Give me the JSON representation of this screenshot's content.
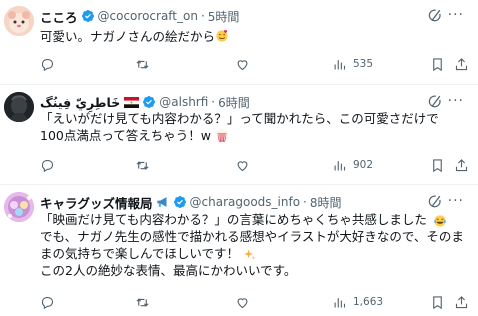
{
  "posts": [
    {
      "name": "こころ",
      "handle": "@cocorocraft_on",
      "sep": "·",
      "time": "5時間",
      "text": "可愛い。ナガノさんの絵だから",
      "views": "535"
    },
    {
      "name": "خَاطِرِيّ فِينُگ",
      "handle": "@alshrfi",
      "sep": "·",
      "time": "6時間",
      "text": "「えいがだけ見ても内容わかる？」って聞かれたら、この可愛さだけで100点満点って答えちゃう！w",
      "views": "902"
    },
    {
      "name": "キャラグッズ情報局",
      "handle": "@charagoods_info",
      "sep": "·",
      "time": "8時間",
      "text": "「映画だけ見ても内容わかる？」の言葉にめちゃくちゃ共感しました\nでも、ナガノ先生の感性で描かれる感想やイラストが大好きなので、そのままの気持ちで楽しんでほしいです！\nこの2人の絶妙な表情、最高にかわいいです。",
      "views": "1,663"
    }
  ],
  "icons": {
    "verified": "verified-badge-icon",
    "grok": "grok-icon",
    "more": "more-icon",
    "reply": "reply-icon",
    "repost": "repost-icon",
    "like": "like-icon",
    "views": "views-icon",
    "bookmark": "bookmark-icon",
    "share": "share-icon"
  },
  "colors": {
    "verified": "#1d9bf0",
    "muted": "#536471",
    "text": "#0f1419",
    "divider": "#eff3f4"
  }
}
